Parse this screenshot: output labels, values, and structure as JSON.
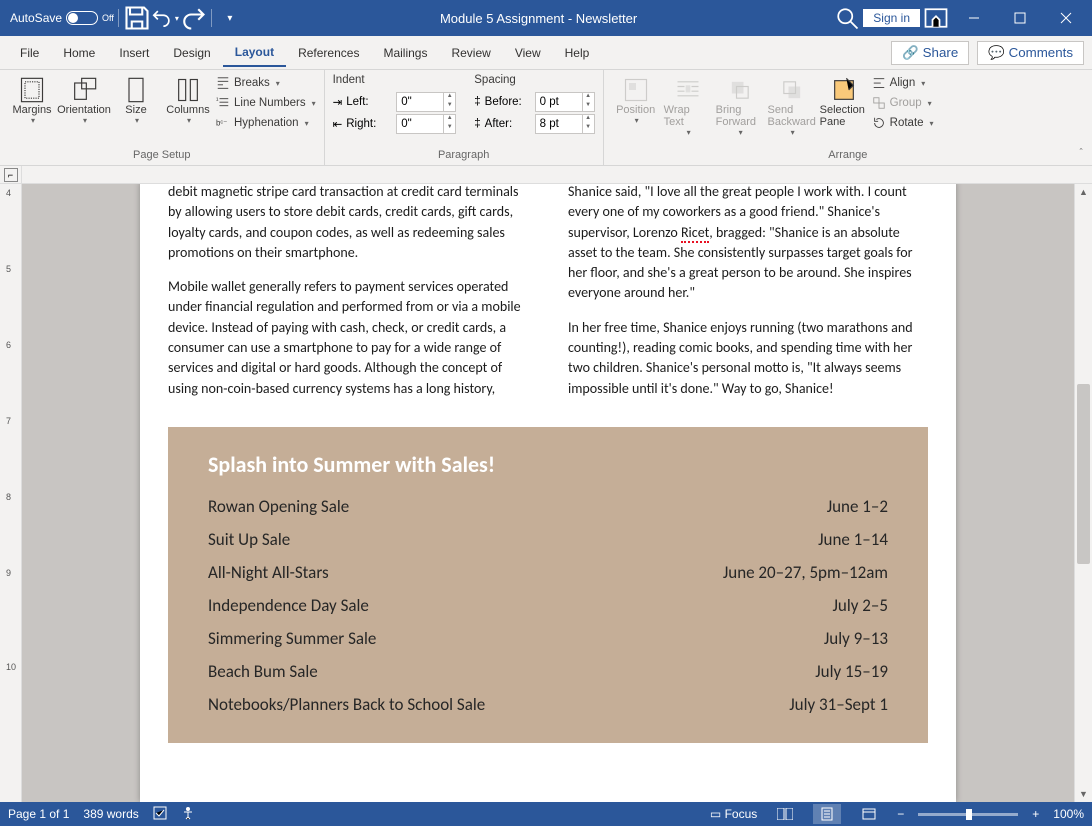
{
  "titlebar": {
    "autosave_label": "AutoSave",
    "autosave_state": "Off",
    "title": "Module 5 Assignment - Newsletter",
    "signin": "Sign in"
  },
  "tabs": {
    "file": "File",
    "home": "Home",
    "insert": "Insert",
    "design": "Design",
    "layout": "Layout",
    "references": "References",
    "mailings": "Mailings",
    "review": "Review",
    "view": "View",
    "help": "Help",
    "share": "Share",
    "comments": "Comments"
  },
  "ribbon": {
    "page_setup": {
      "margins": "Margins",
      "orientation": "Orientation",
      "size": "Size",
      "columns": "Columns",
      "breaks": "Breaks",
      "line_numbers": "Line Numbers",
      "hyphenation": "Hyphenation",
      "group": "Page Setup"
    },
    "paragraph": {
      "indent_head": "Indent",
      "spacing_head": "Spacing",
      "left_label": "Left:",
      "right_label": "Right:",
      "before_label": "Before:",
      "after_label": "After:",
      "left_val": "0\"",
      "right_val": "0\"",
      "before_val": "0 pt",
      "after_val": "8 pt",
      "group": "Paragraph"
    },
    "arrange": {
      "position": "Position",
      "wrap": "Wrap Text",
      "bring": "Bring Forward",
      "send": "Send Backward",
      "selection": "Selection Pane",
      "align": "Align",
      "group_btn": "Group",
      "rotate": "Rotate",
      "group": "Arrange"
    }
  },
  "document": {
    "col1_p1": "debit magnetic stripe card transaction at credit card terminals by allowing users to store debit cards, credit cards, gift cards, loyalty cards, and coupon codes, as well as redeeming sales promotions on their smartphone.",
    "col1_p2": "Mobile wallet generally refers to payment services operated under financial regulation and performed from or via a mobile device. Instead of paying with cash, check, or credit cards, a consumer can use a smartphone to pay for a wide range of services and digital or hard goods. Although the concept of using non-coin-based currency systems has a long history,",
    "col2_p1a": "Shanice said, \"I love all the great people I work with. I count every one of my coworkers as a good friend.\" Shanice's supervisor, Lorenzo ",
    "col2_p1_name": "Ricet",
    "col2_p1b": ", bragged: \"Shanice is an absolute asset to the team. She consistently surpasses target goals for her floor, and she's a great person to be around. She inspires everyone around her.\"",
    "col2_p2": "In her free time, Shanice enjoys running (two marathons and counting!), reading comic books, and spending time with her two children. Shanice's personal motto is, \"It always seems impossible until it's done.\" Way to go, Shanice!",
    "sales_title": "Splash into Summer with Sales!",
    "sales": [
      {
        "name": "Rowan Opening Sale",
        "date": "June 1–2"
      },
      {
        "name": "Suit Up Sale",
        "date": "June 1–14"
      },
      {
        "name": "All-Night All-Stars",
        "date": "June 20–27, 5pm–12am"
      },
      {
        "name": "Independence Day Sale",
        "date": "July 2–5"
      },
      {
        "name": "Simmering Summer Sale",
        "date": "July 9–13"
      },
      {
        "name": "Beach Bum Sale",
        "date": "July 15–19"
      },
      {
        "name": "Notebooks/Planners Back to School Sale",
        "date": "July 31–Sept 1"
      }
    ]
  },
  "statusbar": {
    "page": "Page 1 of 1",
    "words": "389 words",
    "focus": "Focus",
    "zoom": "100%"
  }
}
